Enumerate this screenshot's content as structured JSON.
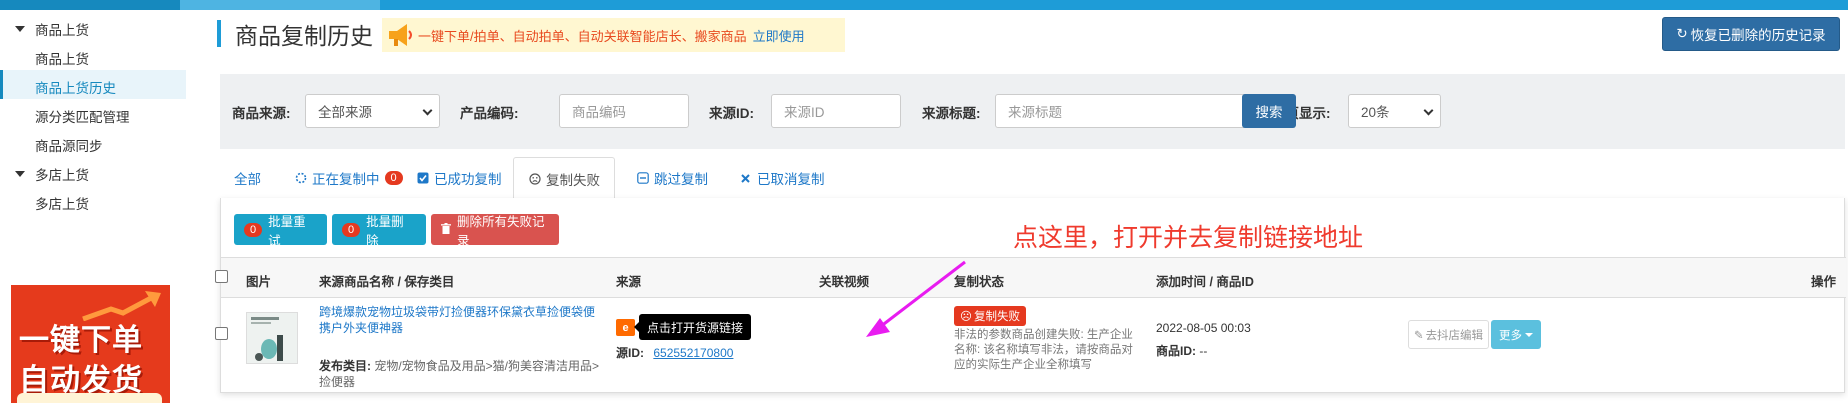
{
  "colors": {
    "accent": "#1e9cd7",
    "primary": "#2e6da4",
    "danger": "#e5391f",
    "info": "#1aa3c9",
    "annotation": "#ef3a2d",
    "arrow": "#e81cf0"
  },
  "sidebar": {
    "groups": [
      {
        "label": "商品上货",
        "items": [
          {
            "label": "商品上货",
            "active": false
          },
          {
            "label": "商品上货历史",
            "active": true
          },
          {
            "label": "源分类匹配管理",
            "active": false
          },
          {
            "label": "商品源同步",
            "active": false
          }
        ]
      },
      {
        "label": "多店上货",
        "items": [
          {
            "label": "多店上货",
            "active": false
          }
        ]
      }
    ],
    "promo": {
      "line1": "一键下单",
      "line2": "自动发货"
    }
  },
  "header": {
    "title": "商品复制历史",
    "notice_text": "一键下单/拍单、自动拍单、自动关联智能店长、搬家商品",
    "notice_link": "立即使用",
    "restore_button": "恢复已删除的历史记录"
  },
  "filters": {
    "source_label": "商品来源:",
    "source_value": "全部来源",
    "code_label": "产品编码:",
    "code_placeholder": "商品编码",
    "srcid_label": "来源ID:",
    "srcid_placeholder": "来源ID",
    "srctitle_label": "来源标题:",
    "srctitle_placeholder": "来源标题",
    "pagesize_label": "每页显示:",
    "pagesize_value": "20条",
    "search_button": "搜索"
  },
  "tabs": [
    {
      "label": "全部",
      "icon": "none",
      "count": null
    },
    {
      "label": "正在复制中",
      "icon": "spinner-icon",
      "count": "0"
    },
    {
      "label": "已成功复制",
      "icon": "check-square-icon",
      "count": null
    },
    {
      "label": "复制失败",
      "icon": "sad-face-icon",
      "count": null,
      "active": true
    },
    {
      "label": "跳过复制",
      "icon": "minus-square-icon",
      "count": null
    },
    {
      "label": "已取消复制",
      "icon": "close-icon",
      "count": null
    }
  ],
  "actions": {
    "batch_retry_count": "0",
    "batch_retry": "批量重试",
    "batch_delete_count": "0",
    "batch_delete": "批量删除",
    "delete_all": "删除所有失败记录"
  },
  "annotation": "点这里，打开并去复制链接地址",
  "table": {
    "headers": {
      "image": "图片",
      "name": "来源商品名称 / 保存类目",
      "source": "来源",
      "video": "关联视频",
      "status": "复制状态",
      "time": "添加时间 / 商品ID",
      "ops": "操作"
    },
    "rows": [
      {
        "name": "跨境爆款宠物垃圾袋带灯捡便器环保黛衣草捡便袋便携户外夹便神器",
        "category_label": "发布类目:",
        "category": "宠物/宠物食品及用品>猫/狗美容清洁用品>捡便器",
        "source_tooltip": "点击打开货源链接",
        "source_id_label": "源ID:",
        "source_id": "652552170800",
        "status_badge": "复制失败",
        "status_message": "非法的参数商品创建失败: 生产企业名称: 该名称填写非法，请按商品对应的实际生产企业全称填写",
        "added_time": "2022-08-05 00:03",
        "product_id_label": "商品ID:",
        "product_id": "--",
        "store_edit": "去抖店编辑",
        "more": "更多"
      }
    ]
  }
}
